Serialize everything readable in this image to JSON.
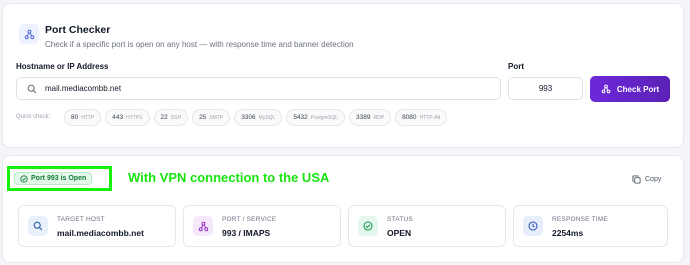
{
  "header": {
    "title": "Port Checker",
    "subtitle": "Check if a specific port is open on any host — with response time and banner detection"
  },
  "form": {
    "host_label": "Hostname or IP Address",
    "host_value": "mail.mediacombb.net",
    "port_label": "Port",
    "port_value": "993",
    "check_button_label": "Check Port"
  },
  "quick_check": {
    "label": "Quick check:",
    "chips": [
      {
        "port": "80",
        "service": "HTTP"
      },
      {
        "port": "443",
        "service": "HTTPS"
      },
      {
        "port": "22",
        "service": "SSH"
      },
      {
        "port": "25",
        "service": "SMTP"
      },
      {
        "port": "3306",
        "service": "MySQL"
      },
      {
        "port": "5432",
        "service": "PostgreSQL"
      },
      {
        "port": "3389",
        "service": "RDP"
      },
      {
        "port": "8080",
        "service": "HTTP-Alt"
      }
    ]
  },
  "result": {
    "badge": "Port 993 is Open",
    "annotation": "With VPN connection to the USA",
    "copy_label": "Copy",
    "stats": {
      "target": {
        "label": "TARGET HOST",
        "value": "mail.mediacombb.net"
      },
      "port": {
        "label": "PORT / SERVICE",
        "value": "993 / IMAPS"
      },
      "status": {
        "label": "STATUS",
        "value": "OPEN"
      },
      "response": {
        "label": "RESPONSE TIME",
        "value": "2254ms"
      }
    }
  },
  "colors": {
    "accent": "#6d28d9",
    "open_green": "#147a3d",
    "annotation_green": "#18e50f"
  },
  "icons": {
    "header": "network-icon",
    "search": "search-icon",
    "button": "network-icon",
    "badge": "check-circle-icon",
    "copy": "copy-icon",
    "target": "search-icon",
    "port": "network-icon",
    "status": "check-circle-icon",
    "response": "clock-icon"
  }
}
